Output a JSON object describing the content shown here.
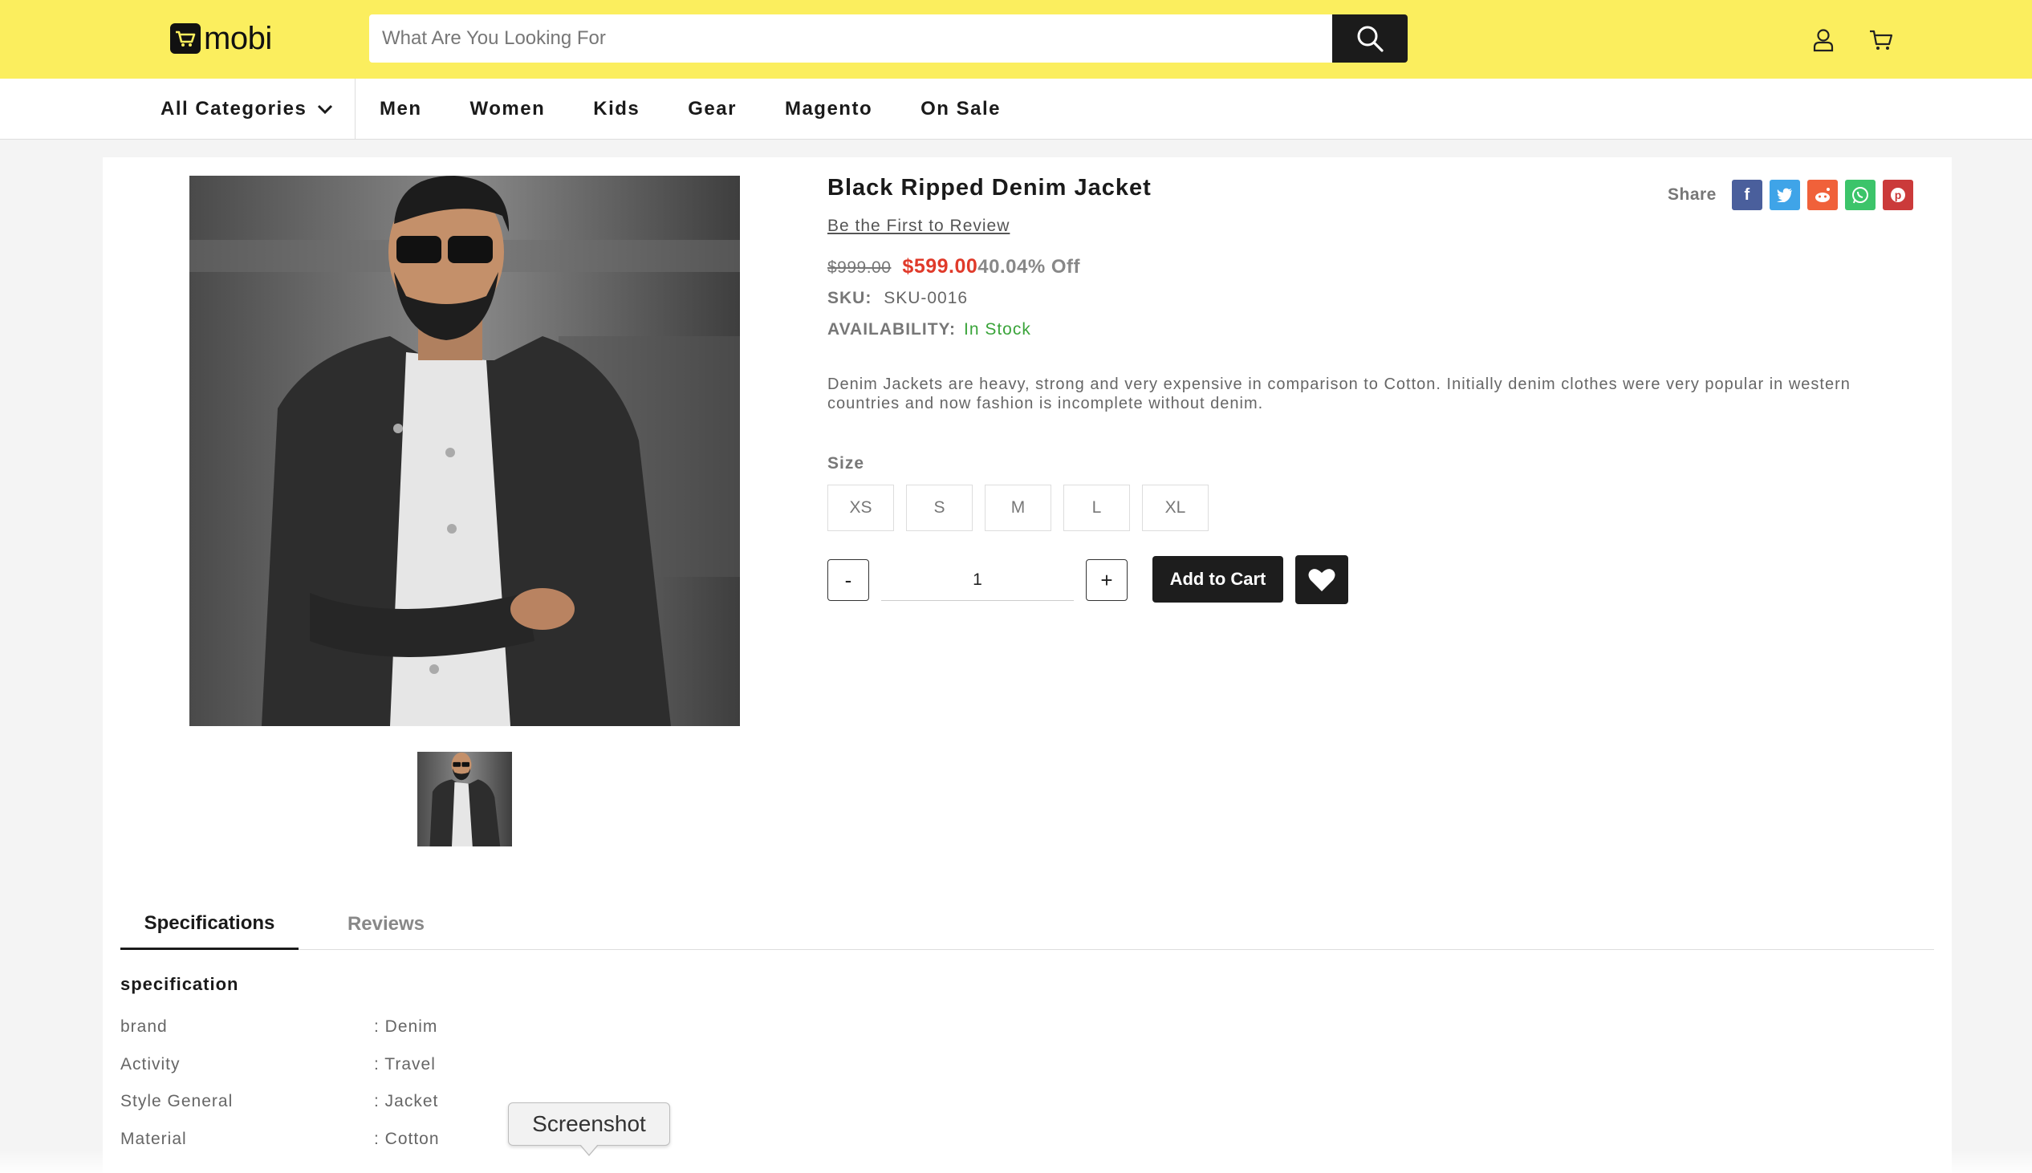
{
  "header": {
    "logo_text": "mobi",
    "search_placeholder": "What Are You Looking For",
    "accent_color": "#fbee5e"
  },
  "nav": {
    "all_categories": "All Categories",
    "items": [
      "Men",
      "Women",
      "Kids",
      "Gear",
      "Magento",
      "On Sale"
    ]
  },
  "product": {
    "title": "Black Ripped Denim Jacket",
    "review_link": "Be the First to Review",
    "old_price": "$999.00",
    "new_price": "$599.00",
    "discount": "40.04% Off",
    "sku_label": "SKU:",
    "sku_value": "SKU-0016",
    "availability_label": "AVAILABILITY:",
    "availability_value": "In Stock",
    "description": "Denim Jackets are heavy, strong and very expensive in comparison to Cotton. Initially denim clothes were very popular in western countries and now fashion is incomplete without denim.",
    "size_label": "Size",
    "sizes": [
      "XS",
      "S",
      "M",
      "L",
      "XL"
    ],
    "qty_minus": "-",
    "qty_plus": "+",
    "quantity": "1",
    "add_to_cart": "Add to Cart"
  },
  "share": {
    "label": "Share",
    "networks": [
      {
        "name": "facebook",
        "glyph": "f",
        "color": "#3b5998"
      },
      {
        "name": "twitter",
        "glyph": "t",
        "color": "#1da1f2"
      },
      {
        "name": "reddit",
        "glyph": "r",
        "color": "#ff4500"
      },
      {
        "name": "whatsapp",
        "glyph": "w",
        "color": "#25d366"
      },
      {
        "name": "pinterest",
        "glyph": "p",
        "color": "#cb2027"
      }
    ]
  },
  "tabs": {
    "specifications": "Specifications",
    "reviews": "Reviews"
  },
  "specs": {
    "heading": "specification",
    "rows": [
      {
        "key": "brand",
        "value": ": Denim"
      },
      {
        "key": "Activity",
        "value": ": Travel"
      },
      {
        "key": "Style General",
        "value": ": Jacket"
      },
      {
        "key": "Material",
        "value": ": Cotton"
      }
    ]
  },
  "tooltip": "Screenshot"
}
